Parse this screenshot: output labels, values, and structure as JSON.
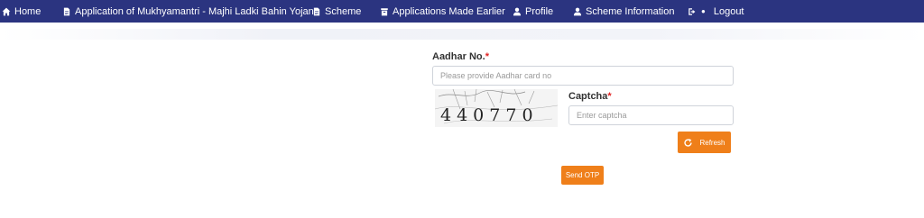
{
  "nav": {
    "home": "Home",
    "application": "Application of Mukhyamantri - Majhi Ladki Bahin Yojana",
    "scheme": "Scheme",
    "applications_earlier": "Applications Made Earlier",
    "profile": "Profile",
    "scheme_information": "Scheme Information",
    "logout": "Logout",
    "color": "#2b3480"
  },
  "form": {
    "aadhar_label": "Aadhar No.",
    "aadhar_placeholder": "Please provide Aadhar card no",
    "aadhar_value": "",
    "captcha_label": "Captcha",
    "captcha_placeholder": "Enter captcha",
    "captcha_value": "",
    "captcha_image_text": "440770",
    "required_mark": "*",
    "refresh_label": "Refresh",
    "send_otp_label": "Send OTP",
    "button_color": "#ef7f1a"
  },
  "icons": {
    "home": "home-icon",
    "application": "document-icon",
    "scheme": "document-icon",
    "applications_earlier": "archive-icon",
    "profile": "user-icon",
    "scheme_information": "user-icon",
    "logout": "sign-out-icon",
    "refresh": "refresh-icon"
  }
}
